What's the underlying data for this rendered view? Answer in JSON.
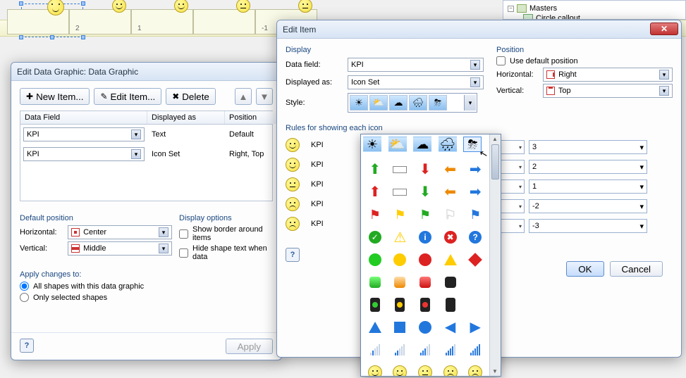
{
  "tree": {
    "masters": "Masters",
    "child": "Circle callout"
  },
  "canvas_numbers": [
    "",
    "2",
    "1",
    "",
    "-1"
  ],
  "edg": {
    "title": "Edit Data Graphic: Data Graphic",
    "new_item": "New Item...",
    "edit_item": "Edit Item...",
    "delete": "Delete",
    "col_datafield": "Data Field",
    "col_displayed": "Displayed as",
    "col_position": "Position",
    "rows": [
      {
        "field": "KPI",
        "displayed": "Text",
        "position": "Default"
      },
      {
        "field": "KPI",
        "displayed": "Icon Set",
        "position": "Right, Top"
      }
    ],
    "default_position": "Default position",
    "horizontal": "Horizontal:",
    "horizontal_val": "Center",
    "vertical": "Vertical:",
    "vertical_val": "Middle",
    "display_options": "Display options",
    "show_border": "Show border around items",
    "hide_shape": "Hide shape text when data",
    "apply_changes": "Apply changes to:",
    "all_shapes": "All shapes with this data graphic",
    "only_selected": "Only selected shapes",
    "apply": "Apply"
  },
  "edi": {
    "title": "Edit Item",
    "display": "Display",
    "data_field": "Data field:",
    "data_field_val": "KPI",
    "displayed_as": "Displayed as:",
    "displayed_as_val": "Icon Set",
    "style": "Style:",
    "rules": "Rules for showing each icon",
    "kpi": "KPI",
    "position": "Position",
    "use_default": "Use default position",
    "horizontal": "Horizontal:",
    "horizontal_val": "Right",
    "vertical": "Vertical:",
    "vertical_val": "Top",
    "values": [
      "3",
      "2",
      "1",
      "-2",
      "-3"
    ],
    "ok": "OK",
    "cancel": "Cancel"
  }
}
